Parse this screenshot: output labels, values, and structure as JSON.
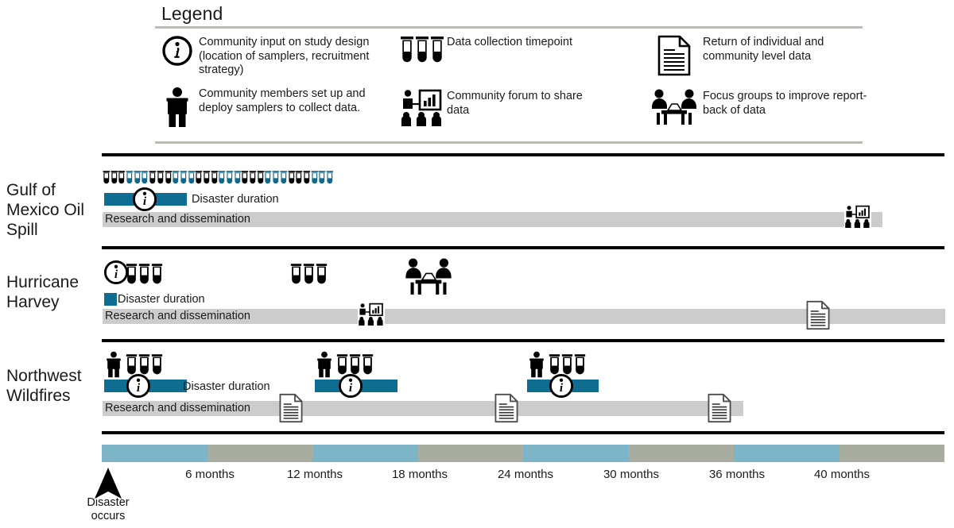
{
  "legend": {
    "title": "Legend",
    "items": [
      {
        "icon": "info-circle-icon",
        "text": "Community input on study design (location of samplers, recruitment strategy)"
      },
      {
        "icon": "person-icon",
        "text": "Community members set up and deploy samplers to collect data."
      },
      {
        "icon": "test-tubes-icon",
        "text": "Data collection timepoint"
      },
      {
        "icon": "presentation-icon",
        "text": "Community forum to share data"
      },
      {
        "icon": "document-icon",
        "text": "Return of individual and community level data"
      },
      {
        "icon": "focus-group-icon",
        "text": "Focus groups to improve report-back of data"
      }
    ]
  },
  "rows": [
    {
      "id": "gulf-of-mexico-oil-spill",
      "label": "Gulf of Mexico Oil Spill",
      "disaster_label": "Disaster duration",
      "research_label": "Research and dissemination"
    },
    {
      "id": "hurricane-harvey",
      "label": "Hurricane Harvey",
      "disaster_label": "Disaster duration",
      "research_label": "Research and dissemination"
    },
    {
      "id": "northwest-wildfires",
      "label": "Northwest Wildfires",
      "disaster_label": "Disaster duration",
      "research_label": "Research and dissemination"
    }
  ],
  "axis": {
    "start_marker_label": "Disaster occurs",
    "ticks": [
      "6 months",
      "12 months",
      "18 months",
      "24 months",
      "30 months",
      "36 months",
      "40 months"
    ]
  },
  "colors": {
    "teal": "#0f6d91",
    "tube_blue": "#12688c",
    "research_gray": "#cccccc",
    "axis_blue": "#7db4c8",
    "axis_gray": "#a8ada0",
    "rule_gray": "#b9bcb3",
    "black": "#000000"
  },
  "chart_data": {
    "type": "timeline",
    "title": "Legend",
    "xlabel": "",
    "ylabel": "",
    "x_unit": "months",
    "xlim": [
      0,
      42
    ],
    "x_ticks": [
      6,
      12,
      18,
      24,
      30,
      36,
      40
    ],
    "x_tick_labels": [
      "6 months",
      "12 months",
      "18 months",
      "24 months",
      "30 months",
      "36 months",
      "40 months"
    ],
    "grid": false,
    "legend": "top",
    "legend_entries": [
      "Community input on study design (location of samplers, recruitment strategy)",
      "Community members set up and deploy samplers to collect data.",
      "Data collection timepoint",
      "Community forum to share data",
      "Return of individual and community level data",
      "Focus groups to improve report-back of data"
    ],
    "series": [
      {
        "name": "Gulf of Mexico Oil Spill",
        "disaster_duration_months": [
          0,
          4.3
        ],
        "research_dissemination_months": [
          0,
          39.0
        ],
        "data_collection_timepoints_months": [
          0.2,
          11.5
        ],
        "data_collection_tube_count": 30,
        "community_input_months": [
          1.9
        ],
        "community_forum_months": [
          37.4
        ],
        "person_setup_months": [],
        "document_return_months": [],
        "focus_group_months": []
      },
      {
        "name": "Hurricane Harvey",
        "disaster_duration_months": [
          0,
          0.6
        ],
        "research_dissemination_months": [
          0,
          40.5
        ],
        "data_collection_timepoints_months": [
          0.5,
          9.8
        ],
        "data_collection_tube_count": 6,
        "community_input_months": [
          0.3
        ],
        "community_forum_months": [
          12.6
        ],
        "person_setup_months": [],
        "document_return_months": [
          35.6
        ],
        "focus_group_months": [
          15.8
        ]
      },
      {
        "name": "Northwest Wildfires",
        "disaster_duration_months": [
          [
            0,
            3.0
          ],
          [
            10.3,
            13.4
          ],
          [
            20.6,
            23.7
          ]
        ],
        "research_dissemination_months": [
          0,
          31.0
        ],
        "data_collection_timepoints_months": [
          0.3,
          11.0,
          21.2
        ],
        "data_collection_tube_count": 9,
        "community_input_months": [
          1.6,
          11.9,
          22.2
        ],
        "person_setup_months": [
          0.3,
          10.5,
          20.8
        ],
        "document_return_months": [
          8.8,
          19.3,
          29.2
        ],
        "community_forum_months": [],
        "focus_group_months": []
      }
    ],
    "axis_band_colors": [
      "#7db4c8",
      "#a8ada0",
      "#7db4c8",
      "#a8ada0",
      "#7db4c8",
      "#a8ada0",
      "#7db4c8",
      "#a8ada0"
    ]
  }
}
